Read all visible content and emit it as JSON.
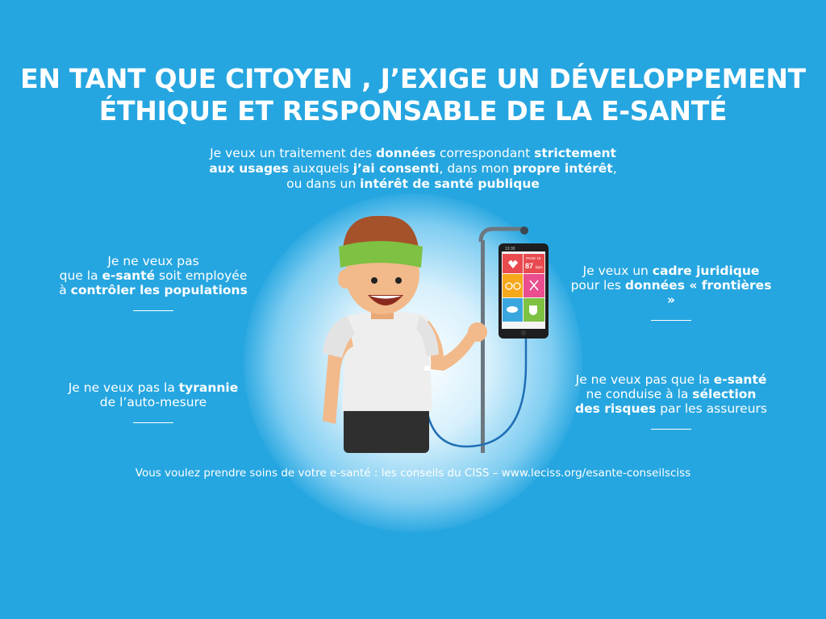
{
  "headline": {
    "line1_a": "EN TANT QUE CITOYEN , J’",
    "line1_b": "EXIGE",
    "line1_c": " UN DÉVELOPPEMENT",
    "line2_a": "ÉTHIQUE",
    "line2_b": " ET ",
    "line2_c": "RESPONSABLE",
    "line2_d": " DE LA E-SANTÉ"
  },
  "lead": {
    "p1": "Je veux un traitement des ",
    "b1": "données",
    "p2": " correspondant ",
    "b2": "strictement",
    "b3": "aux usages",
    "p3": " auxquels ",
    "b4": "j’ai consenti",
    "p4": ", dans mon ",
    "b5": "propre intérêt",
    "p5": ",",
    "p6": "ou dans un ",
    "b6": "intérêt de santé publique"
  },
  "left_top": {
    "l1": "Je ne veux pas",
    "l2a": "que la ",
    "l2b": "e-santé",
    "l2c": " soit employée",
    "l3a": "à ",
    "l3b": "contrôler les populations"
  },
  "left_bottom": {
    "l1a": "Je ne veux pas la ",
    "l1b": "tyrannie",
    "l2": "de l’auto-mesure"
  },
  "right_top": {
    "l1a": "Je veux un ",
    "l1b": "cadre juridique",
    "l2a": "pour les ",
    "l2b": "données « frontières »"
  },
  "right_bottom": {
    "l1a": "Je ne veux pas que  la ",
    "l1b": "e-santé",
    "l2a": "ne conduise à la ",
    "l2b": "sélection",
    "l3a": "des risques",
    "l3b": " par les assureurs"
  },
  "footer": "Vous voulez prendre soins de votre e-santé : les conseils du CISS – www.leciss.org/esante-conseilsciss",
  "phone": {
    "time": "13:30",
    "date": "PAGE 18",
    "bpm": "87",
    "bpm_unit": "bpm"
  },
  "colors": {
    "background": "#26a6e0",
    "headband": "#7ec143",
    "hair": "#a5522b",
    "shirt": "#eeeeee",
    "shorts": "#2f2f2f",
    "tile_red": "#e84a4f",
    "tile_orange": "#f6a81c",
    "tile_pink": "#ea4e8e",
    "tile_blue": "#3aa6e0",
    "tile_green": "#7ec143"
  }
}
